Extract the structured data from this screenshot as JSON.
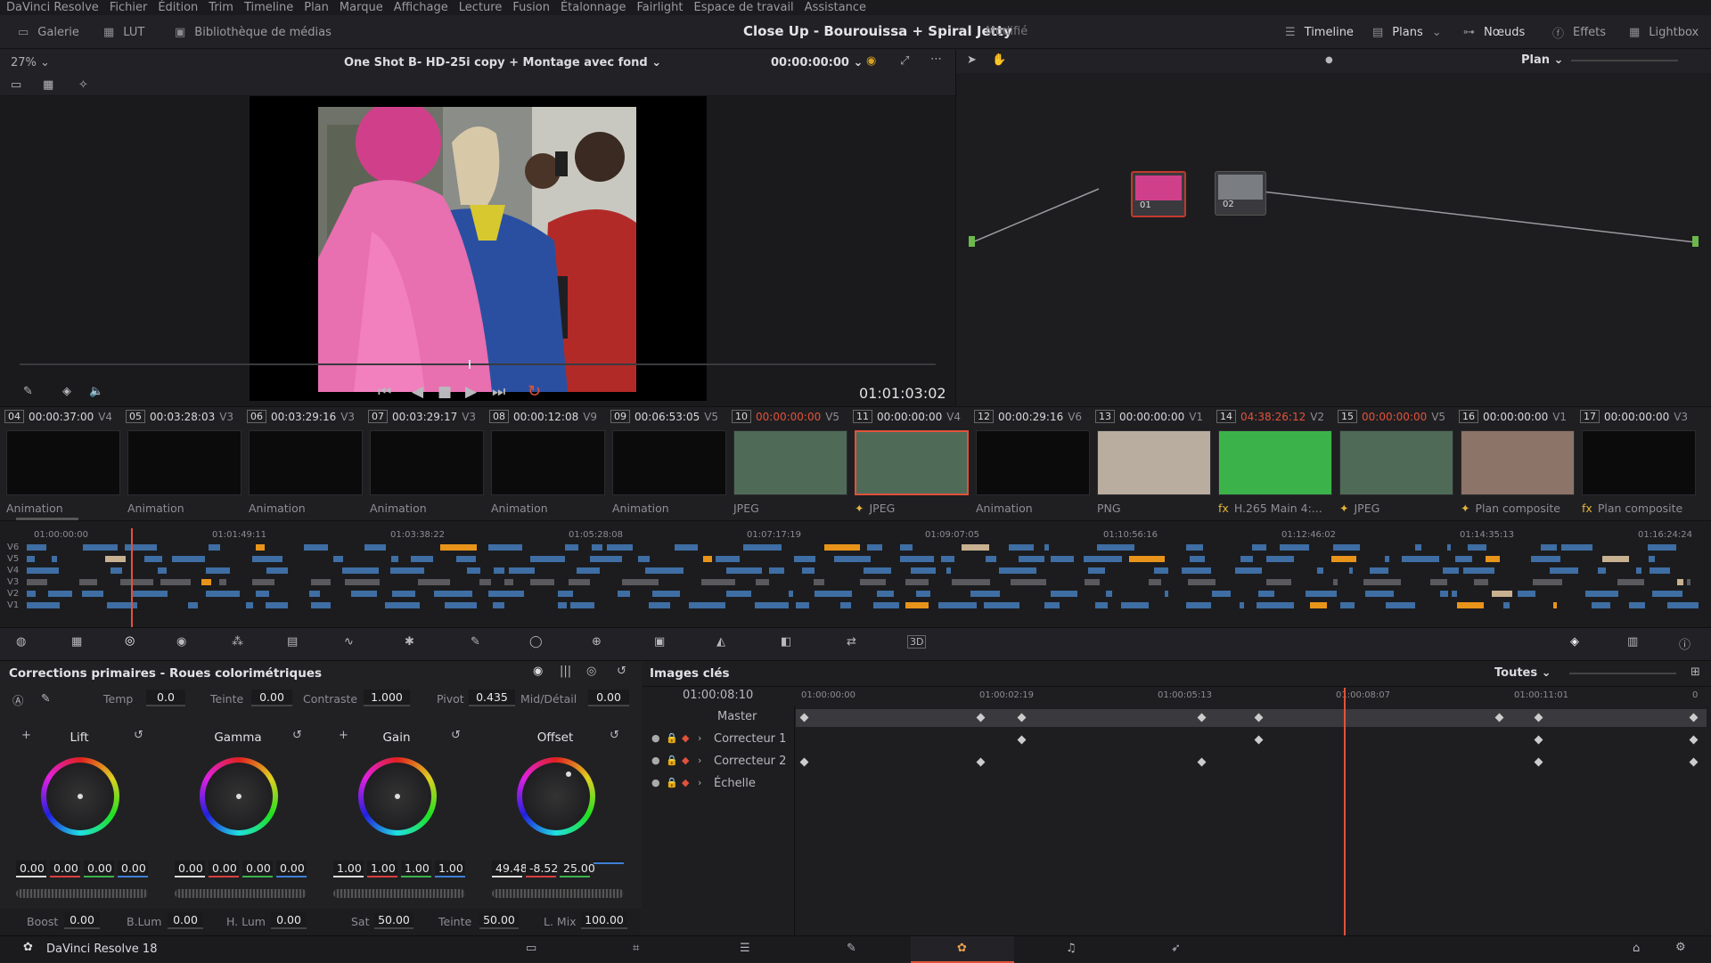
{
  "menu": [
    "DaVinci Resolve",
    "Fichier",
    "Édition",
    "Trim",
    "Timeline",
    "Plan",
    "Marque",
    "Affichage",
    "Lecture",
    "Fusion",
    "Étalonnage",
    "Fairlight",
    "Espace de travail",
    "Assistance"
  ],
  "toolbar": {
    "gallery": "Galerie",
    "lut": "LUT",
    "media": "Bibliothèque de médias",
    "project_title": "Close Up - Bourouissa + Spiral Jetty",
    "modified": "Modifié",
    "timeline": "Timeline",
    "clips": "Plans",
    "nodes": "Nœuds",
    "effects": "Effets",
    "lightbox": "Lightbox"
  },
  "viewer": {
    "zoom": "27%",
    "clip_name": "One Shot B- HD-25i copy + Montage  avec fond",
    "timecode": "00:00:00:00",
    "playhead_tc": "01:01:03:02",
    "mode": "Plan",
    "scrub_position": 0.49
  },
  "nodes": [
    {
      "label": "01"
    },
    {
      "label": "02"
    }
  ],
  "clips": [
    {
      "num": "04",
      "tc": "00:00:37:00",
      "track": "V4",
      "label": "Animation",
      "tc_red": false,
      "fx": ""
    },
    {
      "num": "05",
      "tc": "00:03:28:03",
      "track": "V3",
      "label": "Animation",
      "tc_red": false,
      "fx": ""
    },
    {
      "num": "06",
      "tc": "00:03:29:16",
      "track": "V3",
      "label": "Animation",
      "tc_red": false,
      "fx": ""
    },
    {
      "num": "07",
      "tc": "00:03:29:17",
      "track": "V3",
      "label": "Animation",
      "tc_red": false,
      "fx": ""
    },
    {
      "num": "08",
      "tc": "00:00:12:08",
      "track": "V9",
      "label": "Animation",
      "tc_red": false,
      "fx": ""
    },
    {
      "num": "09",
      "tc": "00:06:53:05",
      "track": "V5",
      "label": "Animation",
      "tc_red": false,
      "fx": ""
    },
    {
      "num": "10",
      "tc": "00:00:00:00",
      "track": "V5",
      "label": "JPEG",
      "tc_red": true,
      "fx": ""
    },
    {
      "num": "11",
      "tc": "00:00:00:00",
      "track": "V4",
      "label": "JPEG",
      "tc_red": false,
      "fx": "✦"
    },
    {
      "num": "12",
      "tc": "00:00:29:16",
      "track": "V6",
      "label": "Animation",
      "tc_red": false,
      "fx": ""
    },
    {
      "num": "13",
      "tc": "00:00:00:00",
      "track": "V1",
      "label": "PNG",
      "tc_red": false,
      "fx": ""
    },
    {
      "num": "14",
      "tc": "04:38:26:12",
      "track": "V2",
      "label": "H.265 Main 4:...",
      "tc_red": true,
      "fx": "fx"
    },
    {
      "num": "15",
      "tc": "00:00:00:00",
      "track": "V5",
      "label": "JPEG",
      "tc_red": true,
      "fx": "✦"
    },
    {
      "num": "16",
      "tc": "00:00:00:00",
      "track": "V1",
      "label": "Plan composite",
      "tc_red": false,
      "fx": "✦"
    },
    {
      "num": "17",
      "tc": "00:00:00:00",
      "track": "V3",
      "label": "Plan composite",
      "tc_red": false,
      "fx": "fx"
    }
  ],
  "timeline": {
    "ruler": [
      "01:00:00:00",
      "01:01:49:11",
      "01:03:38:22",
      "01:05:28:08",
      "01:07:17:19",
      "01:09:07:05",
      "01:10:56:16",
      "01:12:46:02",
      "01:14:35:13",
      "01:16:24:24"
    ],
    "tracks": [
      "V6",
      "V5",
      "V4",
      "V3",
      "V2",
      "V1"
    ]
  },
  "color": {
    "title": "Corrections primaires - Roues colorimétriques",
    "temp_label": "Temp",
    "temp": "0.0",
    "tint_label": "Teinte",
    "tint": "0.00",
    "contrast_label": "Contraste",
    "contrast": "1.000",
    "pivot_label": "Pivot",
    "pivot": "0.435",
    "middetail_label": "Mid/Détail",
    "middetail": "0.00",
    "wheels": [
      {
        "name": "Lift",
        "values": [
          "0.00",
          "0.00",
          "0.00",
          "0.00"
        ]
      },
      {
        "name": "Gamma",
        "values": [
          "0.00",
          "0.00",
          "0.00",
          "0.00"
        ]
      },
      {
        "name": "Gain",
        "values": [
          "1.00",
          "1.00",
          "1.00",
          "1.00"
        ]
      },
      {
        "name": "Offset",
        "values": [
          "49.48",
          "-8.52",
          "25.00",
          ""
        ]
      }
    ],
    "boost_label": "Boost",
    "boost": "0.00",
    "blum_label": "B.Lum",
    "blum": "0.00",
    "hlum_label": "H. Lum",
    "hlum": "0.00",
    "sat_label": "Sat",
    "sat": "50.00",
    "hue_label": "Teinte",
    "hue": "50.00",
    "lmix_label": "L. Mix",
    "lmix": "100.00"
  },
  "keyframes": {
    "title": "Images clés",
    "filter": "Toutes",
    "current_tc": "01:00:08:10",
    "ruler": [
      "01:00:00:00",
      "01:00:02:19",
      "01:00:05:13",
      "01:00:08:07",
      "01:00:11:01",
      "0"
    ],
    "rows": [
      "Master",
      "Correcteur 1",
      "Correcteur 2",
      "Échelle"
    ]
  },
  "bottom": {
    "app": "DaVinci Resolve 18"
  }
}
